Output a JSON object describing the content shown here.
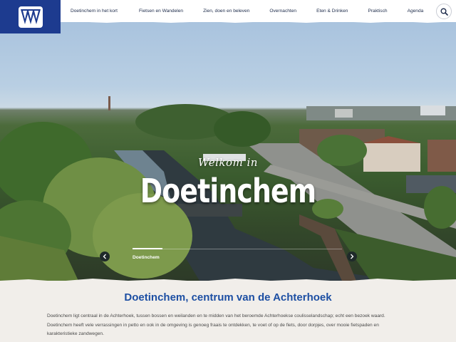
{
  "header": {
    "logo": {
      "name": "vvv-logo"
    },
    "nav": [
      {
        "label": "Doetinchem in het kort"
      },
      {
        "label": "Fietsen en Wandelen"
      },
      {
        "label": "Zien, doen en beleven"
      },
      {
        "label": "Overnachten"
      },
      {
        "label": "Eten & Drinken"
      },
      {
        "label": "Praktisch"
      },
      {
        "label": "Agenda"
      }
    ],
    "search_icon": "search-icon"
  },
  "hero": {
    "subtitle": "Welkom in",
    "title": "Doetinchem",
    "slide_label": "Doetinchem",
    "prev_icon": "chevron-left-icon",
    "next_icon": "chevron-right-icon"
  },
  "intro": {
    "title": "Doetinchem, centrum van de Achterhoek",
    "text": "Doetinchem ligt centraal in de Achterhoek, tussen bossen en weilanden en te midden van het beroemde Achterhoekse coulisselandschap; echt een bezoek waard. Doetinchem heeft vele verrassingen in petto en ook in de omgeving is genoeg fraais te ontdekken, te voet of op de fiets, door dorpjes, over mooie fietspaden en karakteristieke zandwegen."
  },
  "colors": {
    "brand_blue": "#1d3b8f",
    "title_blue": "#1d4fa3",
    "content_bg": "#f1eeea"
  }
}
